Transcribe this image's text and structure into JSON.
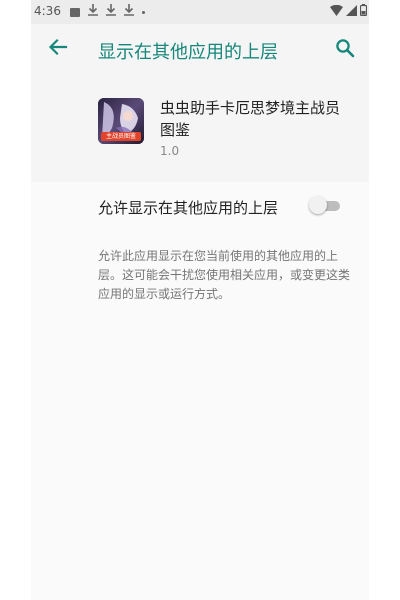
{
  "status_bar": {
    "time": "4:36"
  },
  "app_bar": {
    "title": "显示在其他应用的上层",
    "title_color": "#16877a"
  },
  "app": {
    "name": "虫虫助手卡厄思梦境主战员图鉴",
    "version": "1.0",
    "icon_badge_text": "主战员图鉴"
  },
  "setting": {
    "toggle_label": "允许显示在其他应用的上层",
    "toggle_on": false,
    "description": "允许此应用显示在您当前使用的其他应用的上层。这可能会干扰您使用相关应用，或变更这类应用的显示或运行方式。"
  },
  "icons": {
    "back": "arrow-left-icon",
    "search": "search-icon"
  }
}
